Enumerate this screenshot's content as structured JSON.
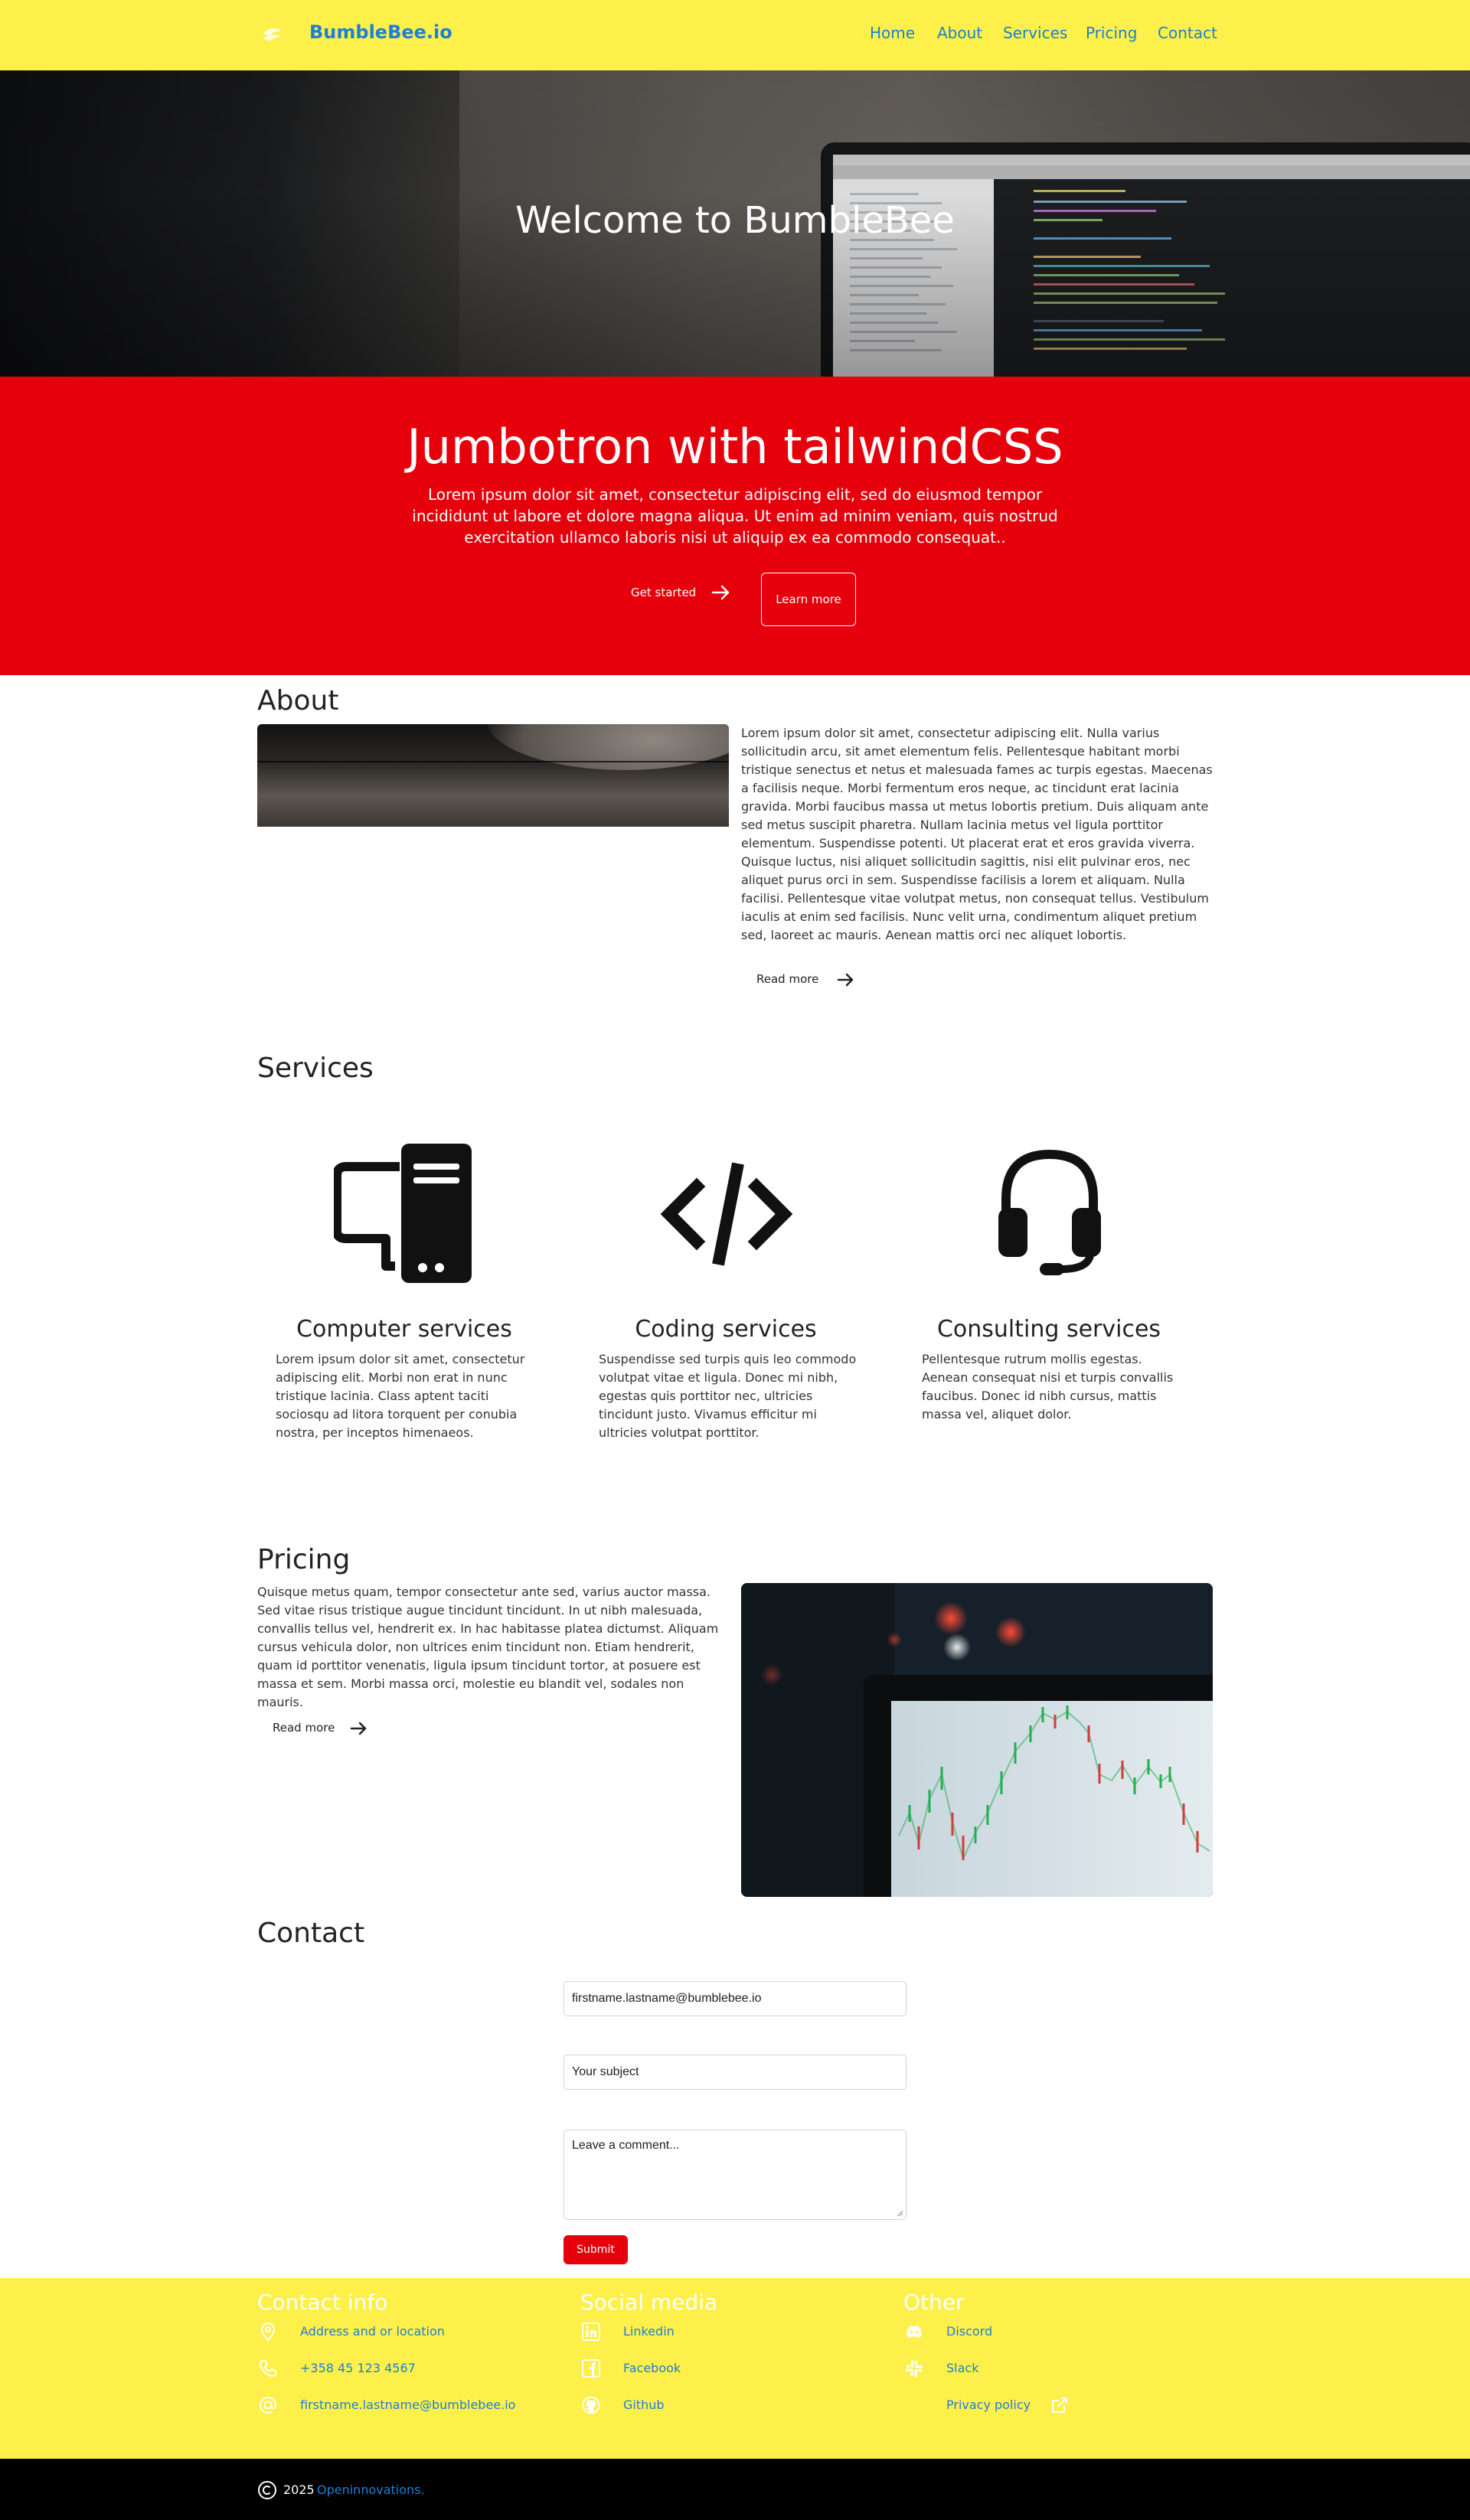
{
  "nav": {
    "brand": "BumbleBee.io",
    "links": [
      "Home",
      "About",
      "Services",
      "Pricing",
      "Contact"
    ]
  },
  "hero": {
    "title": "Welcome to BumbleBee"
  },
  "jumbotron": {
    "title": "Jumbotron with tailwindCSS",
    "text": "Lorem ipsum dolor sit amet, consectetur adipiscing elit, sed do eiusmod tempor incididunt ut labore et dolore magna aliqua. Ut enim ad minim veniam, quis nostrud exercitation ullamco laboris nisi ut aliquip ex ea commodo consequat..",
    "primary_label": "Get started",
    "secondary_label": "Learn more"
  },
  "about": {
    "heading": "About",
    "text": "Lorem ipsum dolor sit amet, consectetur adipiscing elit. Nulla varius sollicitudin arcu, sit amet elementum felis. Pellentesque habitant morbi tristique senectus et netus et malesuada fames ac turpis egestas. Maecenas a facilisis neque. Morbi fermentum eros neque, ac tincidunt erat lacinia gravida. Morbi faucibus massa ut metus lobortis pretium. Duis aliquam ante sed metus suscipit pharetra. Nullam lacinia metus vel ligula porttitor elementum. Suspendisse potenti. Ut placerat erat et eros gravida viverra. Quisque luctus, nisi aliquet sollicitudin sagittis, nisi elit pulvinar eros, nec aliquet purus orci in sem. Suspendisse facilisis a lorem et aliquam. Nulla facilisi. Pellentesque vitae volutpat metus, non consequat tellus. Vestibulum iaculis at enim sed facilisis. Nunc velit urna, condimentum aliquet pretium sed, laoreet ac mauris. Aenean mattis orci nec aliquet lobortis.",
    "read_more": "Read more"
  },
  "services": {
    "heading": "Services",
    "items": [
      {
        "icon": "computer-icon",
        "title": "Computer services",
        "text": "Lorem ipsum dolor sit amet, consectetur adipiscing elit. Morbi non erat in nunc tristique lacinia. Class aptent taciti sociosqu ad litora torquent per conubia nostra, per inceptos himenaeos."
      },
      {
        "icon": "code-icon",
        "title": "Coding services",
        "text": "Suspendisse sed turpis quis leo commodo volutpat vitae et ligula. Donec mi nibh, egestas quis porttitor nec, ultricies tincidunt justo. Vivamus efficitur mi ultricies volutpat porttitor."
      },
      {
        "icon": "headset-icon",
        "title": "Consulting services",
        "text": "Pellentesque rutrum mollis egestas. Aenean consequat nisi et turpis convallis faucibus. Donec id nibh cursus, mattis massa vel, aliquet dolor."
      }
    ]
  },
  "pricing": {
    "heading": "Pricing",
    "text": "Quisque metus quam, tempor consectetur ante sed, varius auctor massa. Sed vitae risus tristique augue tincidunt tincidunt. In ut nibh malesuada, convallis tellus vel, hendrerit ex. In hac habitasse platea dictumst. Aliquam cursus vehicula dolor, non ultrices enim tincidunt non. Etiam hendrerit, quam id porttitor venenatis, ligula ipsum tincidunt tortor, at posuere est massa et sem. Morbi massa orci, molestie eu blandit vel, sodales non mauris.",
    "read_more": "Read more"
  },
  "contact": {
    "heading": "Contact",
    "email_value": "firstname.lastname@bumblebee.io",
    "subject_value": "Your subject",
    "comment_placeholder": "Leave a comment...",
    "submit_label": "Submit"
  },
  "footer": {
    "columns": [
      {
        "heading": "Contact info",
        "items": [
          {
            "icon": "location-pin-icon",
            "label": "Address and or location"
          },
          {
            "icon": "phone-icon",
            "label": "+358 45 123 4567"
          },
          {
            "icon": "at-sign-icon",
            "label": "firstname.lastname@bumblebee.io"
          }
        ]
      },
      {
        "heading": "Social media",
        "items": [
          {
            "icon": "linkedin-icon",
            "label": "Linkedin"
          },
          {
            "icon": "facebook-icon",
            "label": "Facebook"
          },
          {
            "icon": "github-icon",
            "label": "Github"
          }
        ]
      },
      {
        "heading": "Other",
        "items": [
          {
            "icon": "discord-icon",
            "label": "Discord"
          },
          {
            "icon": "slack-icon",
            "label": "Slack"
          },
          {
            "icon": "external-link-icon",
            "label": "Privacy policy"
          }
        ]
      }
    ],
    "copyright_year": "2025",
    "copyright_link": "Openinnovations."
  },
  "colors": {
    "nav_bg": "#fdf04a",
    "link": "#1e7fd6",
    "accent_red": "#e6000b",
    "footer_bg": "#fdf04a",
    "bottom_bar": "#000000"
  }
}
